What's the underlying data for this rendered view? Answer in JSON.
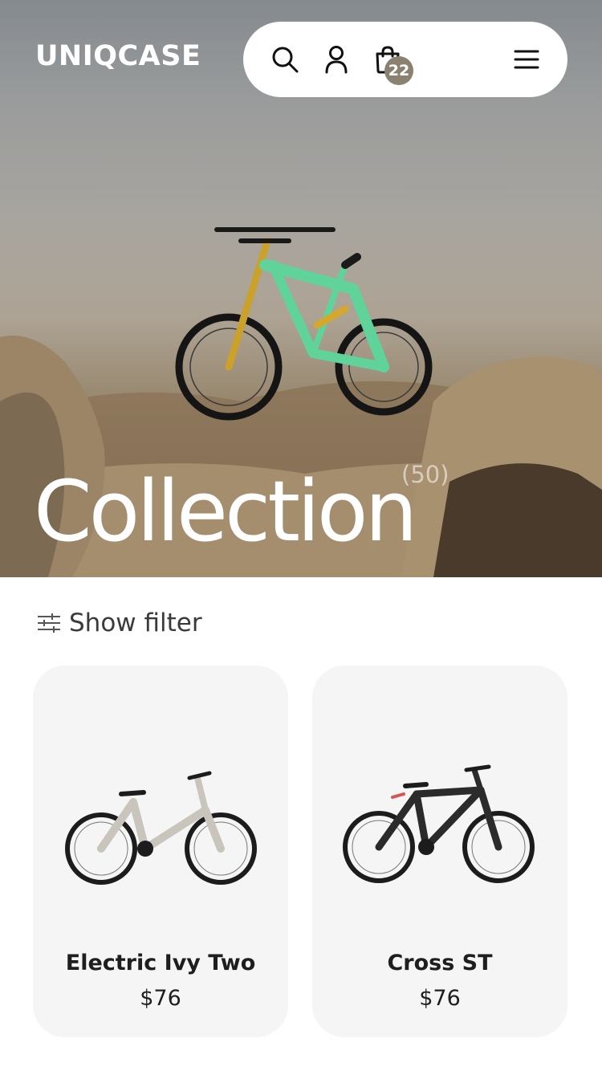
{
  "brand": {
    "logo_text": "UNIQCASE"
  },
  "header": {
    "icons": [
      "search-icon",
      "user-icon",
      "shopping-bag-icon",
      "menu-icon"
    ],
    "cart_count": "22"
  },
  "hero": {
    "title": "Collection",
    "count": "(50)"
  },
  "filter": {
    "label": "Show filter",
    "icon": "sliders-icon"
  },
  "products": [
    {
      "name": "Electric Ivy Two",
      "price": "$76",
      "frame_color": "#c9c4bc"
    },
    {
      "name": "Cross ST",
      "price": "$76",
      "frame_color": "#2b2b2b"
    }
  ],
  "colors": {
    "accent_bike": "#5fd39a",
    "card_bg": "#f5f5f5",
    "badge": "#8a8170"
  }
}
